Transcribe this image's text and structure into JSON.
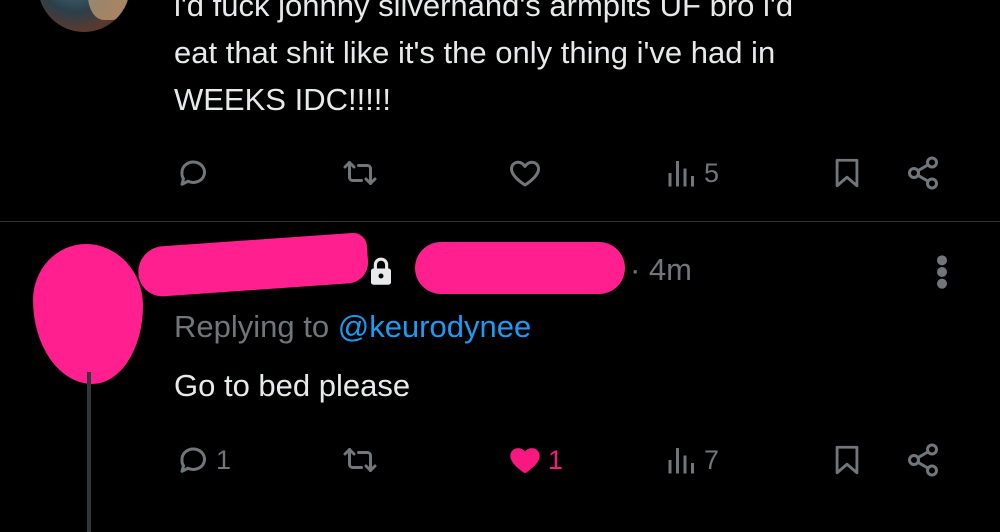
{
  "top_tweet": {
    "text_line_1": "i'd fuck johnny silverhand's armpits UF bro i'd",
    "text_line_2": "eat that shit like it's the only thing i've had in",
    "text_line_3": "WEEKS IDC!!!!!",
    "actions": {
      "reply_count": "",
      "retweet_count": "",
      "like_count": "",
      "views_count": "5"
    }
  },
  "reply_tweet": {
    "time": "· 4m",
    "replying_prefix": "Replying to ",
    "replying_handle": "@keurodynee",
    "text": "Go to bed please",
    "actions": {
      "reply_count": "1",
      "retweet_count": "",
      "like_count": "1",
      "views_count": "7"
    }
  },
  "colors": {
    "background": "#000000",
    "text": "#e7e9ea",
    "muted": "#71767b",
    "link": "#1d9bf0",
    "like_active": "#f91880",
    "redaction": "#ff1f8e",
    "divider": "#2f3336"
  },
  "icons": [
    "reply-icon",
    "retweet-icon",
    "like-icon",
    "views-icon",
    "bookmark-icon",
    "share-icon",
    "lock-icon",
    "more-icon"
  ]
}
